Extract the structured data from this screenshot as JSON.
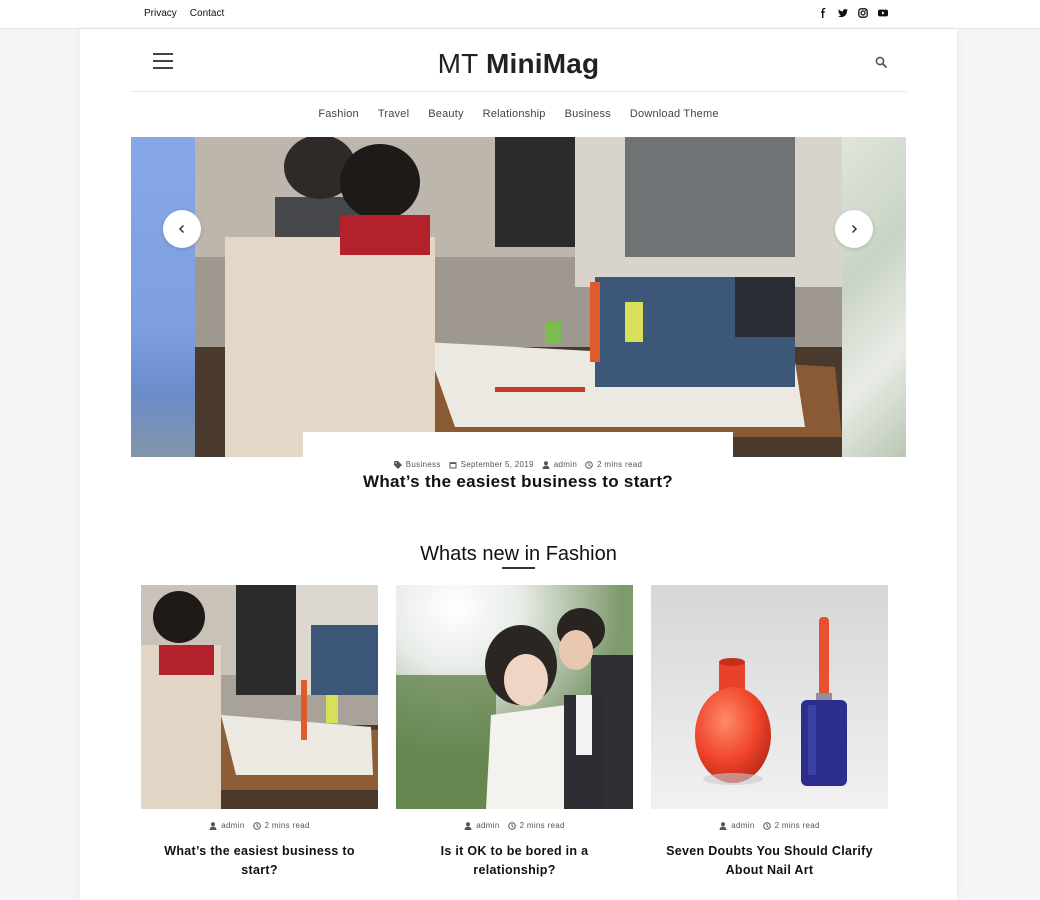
{
  "topbar": {
    "links": [
      "Privacy",
      "Contact"
    ],
    "social": [
      "facebook-icon",
      "twitter-icon",
      "instagram-icon",
      "youtube-icon"
    ]
  },
  "header": {
    "brand_light": "MT",
    "brand_bold": "MiniMag"
  },
  "nav": {
    "items": [
      "Fashion",
      "Travel",
      "Beauty",
      "Relationship",
      "Business",
      "Download Theme"
    ]
  },
  "slider": {
    "category": "Business",
    "date": "September 5, 2019",
    "author": "admin",
    "read_time": "2 mins read",
    "title": "What’s the easiest business to start?"
  },
  "section": {
    "title": "Whats new in Fashion"
  },
  "posts": [
    {
      "author": "admin",
      "read_time": "2 mins read",
      "title": "What’s the easiest business to start?"
    },
    {
      "author": "admin",
      "read_time": "2 mins read",
      "title": "Is it OK to be bored in a relationship?"
    },
    {
      "author": "admin",
      "read_time": "2 mins read",
      "title": "Seven Doubts You Should Clarify About Nail Art"
    }
  ],
  "colors": {
    "background": "#f4f5f7",
    "card": "#ffffff",
    "text": "#111111"
  }
}
